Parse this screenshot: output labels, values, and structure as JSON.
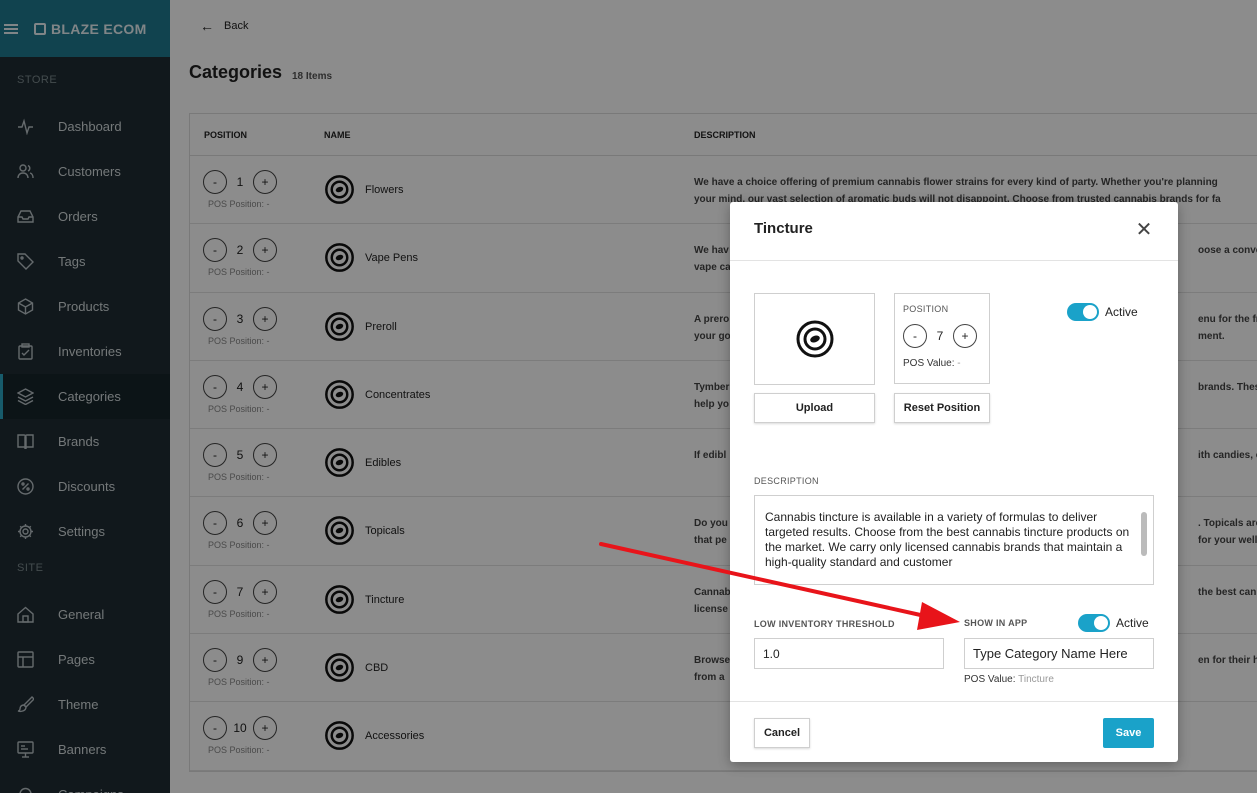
{
  "sidebar": {
    "brand": "BLAZE ECOM",
    "store_label": "STORE",
    "site_label": "SITE",
    "store_items": [
      {
        "label": "Dashboard",
        "icon": "activity-icon"
      },
      {
        "label": "Customers",
        "icon": "users-icon"
      },
      {
        "label": "Orders",
        "icon": "inbox-icon"
      },
      {
        "label": "Tags",
        "icon": "tag-icon"
      },
      {
        "label": "Products",
        "icon": "box-icon"
      },
      {
        "label": "Inventories",
        "icon": "clipboard-icon"
      },
      {
        "label": "Categories",
        "icon": "layers-icon",
        "active": true
      },
      {
        "label": "Brands",
        "icon": "book-icon"
      },
      {
        "label": "Discounts",
        "icon": "percent-icon"
      },
      {
        "label": "Settings",
        "icon": "gear-icon"
      }
    ],
    "site_items": [
      {
        "label": "General",
        "icon": "home-icon"
      },
      {
        "label": "Pages",
        "icon": "layout-icon"
      },
      {
        "label": "Theme",
        "icon": "brush-icon"
      },
      {
        "label": "Banners",
        "icon": "monitor-icon"
      },
      {
        "label": "Campaigns",
        "icon": "bell-icon"
      }
    ]
  },
  "header": {
    "back_label": "Back",
    "title": "Categories",
    "count": "18 Items"
  },
  "table": {
    "columns": [
      "POSITION",
      "NAME",
      "DESCRIPTION"
    ],
    "pos_note_label": "POS Position: -",
    "rows": [
      {
        "position": "1",
        "name": "Flowers",
        "desc1": "We have a choice offering of premium cannabis flower strains for every kind of party. Whether you're planning",
        "desc2": "your mind, our vast selection of aromatic buds will not disappoint. Choose from trusted cannabis brands for fa"
      },
      {
        "position": "2",
        "name": "Vape Pens",
        "desc1": "We hav",
        "desc2": "vape ca"
      },
      {
        "position": "3",
        "name": "Preroll",
        "desc1": "A prero",
        "desc2": "your go"
      },
      {
        "position": "4",
        "name": "Concentrates",
        "desc1": "Tymber",
        "desc2": "help yo"
      },
      {
        "position": "5",
        "name": "Edibles",
        "desc1": "If edibl",
        "desc2": ""
      },
      {
        "position": "6",
        "name": "Topicals",
        "desc1": "Do you",
        "desc2": "that pe"
      },
      {
        "position": "7",
        "name": "Tincture",
        "desc1": "Cannab",
        "desc2": "license"
      },
      {
        "position": "9",
        "name": "CBD",
        "desc1": "Browse",
        "desc2": "from a"
      },
      {
        "position": "10",
        "name": "Accessories",
        "desc1": "",
        "desc2": ""
      }
    ],
    "right_fragments": [
      {
        "row": 1,
        "line1": "oose a convenie",
        "line2": ""
      },
      {
        "row": 2,
        "line1": "enu for the fres",
        "line2": "ment."
      },
      {
        "row": 3,
        "line1": "brands. These p",
        "line2": ""
      },
      {
        "row": 4,
        "line1": "ith candies, cho",
        "line2": ""
      },
      {
        "row": 5,
        "line1": ". Topicals are a",
        "line2": "for your wellne"
      },
      {
        "row": 6,
        "line1": "the best cannab",
        "line2": ""
      },
      {
        "row": 7,
        "line1": "en for their high",
        "line2": ""
      }
    ]
  },
  "modal": {
    "title": "Tincture",
    "position_label": "POSITION",
    "position_value": "7",
    "pos_value_label": "POS Value:",
    "pos_value": "-",
    "active_label": "Active",
    "upload_label": "Upload",
    "reset_label": "Reset Position",
    "description_label": "DESCRIPTION",
    "description": "Cannabis tincture is available in a variety of formulas to deliver targeted results. Choose from the best cannabis tincture products on the market. We carry only licensed cannabis brands that maintain a high-quality standard and customer",
    "low_inventory_label": "LOW INVENTORY THRESHOLD",
    "low_inventory_value": "1.0",
    "show_in_app_label": "SHOW IN APP",
    "show_in_app_active": "Active",
    "category_name_placeholder": "Type Category Name Here",
    "pos_value2_label": "POS Value:",
    "pos_value2": "Tincture",
    "cancel_label": "Cancel",
    "save_label": "Save"
  },
  "colors": {
    "accent": "#1aa2c9",
    "sidebar_bg": "#1f2d33",
    "brand_bg": "#1f7a91",
    "annotation_arrow": "#e8141a"
  }
}
